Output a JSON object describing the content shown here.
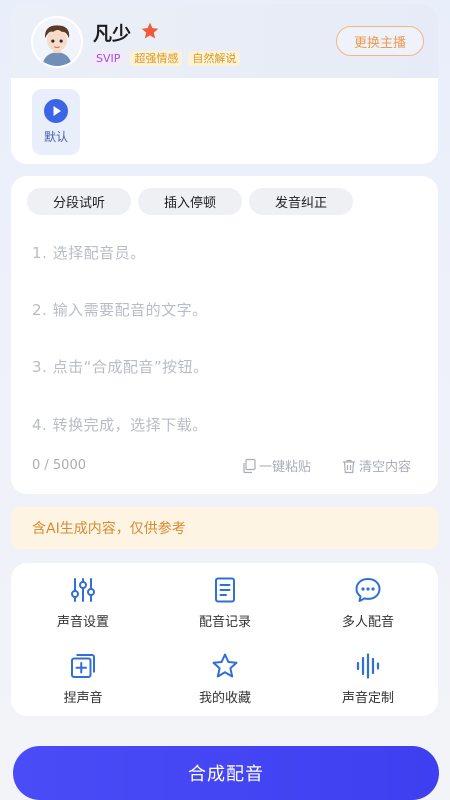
{
  "anchor": {
    "name": "凡少",
    "tags": [
      "SVIP",
      "超强情感",
      "自然解说"
    ],
    "change_label": "更换主播",
    "style_label": "默认"
  },
  "editor": {
    "chips": [
      "分段试听",
      "插入停顿",
      "发音纠正"
    ],
    "placeholder_lines": [
      "1. 选择配音员。",
      "2. 输入需要配音的文字。",
      "3. 点击“合成配音”按钮。",
      "4. 转换完成，选择下载。"
    ],
    "counter": "0 / 5000",
    "paste_label": "一键粘贴",
    "clear_label": "清空内容"
  },
  "notice": "含AI生成内容，仅供参考",
  "features": [
    {
      "label": "声音设置",
      "icon": "sliders-icon"
    },
    {
      "label": "配音记录",
      "icon": "document-icon"
    },
    {
      "label": "多人配音",
      "icon": "chat-icon"
    },
    {
      "label": "捏声音",
      "icon": "add-square-icon"
    },
    {
      "label": "我的收藏",
      "icon": "star-outline-icon"
    },
    {
      "label": "声音定制",
      "icon": "waveform-icon"
    }
  ],
  "synthesize_label": "合成配音",
  "colors": {
    "accent": "#4345f4",
    "icon_blue": "#2f6fd6",
    "orange": "#ee9a52",
    "star": "#f35a3b"
  }
}
